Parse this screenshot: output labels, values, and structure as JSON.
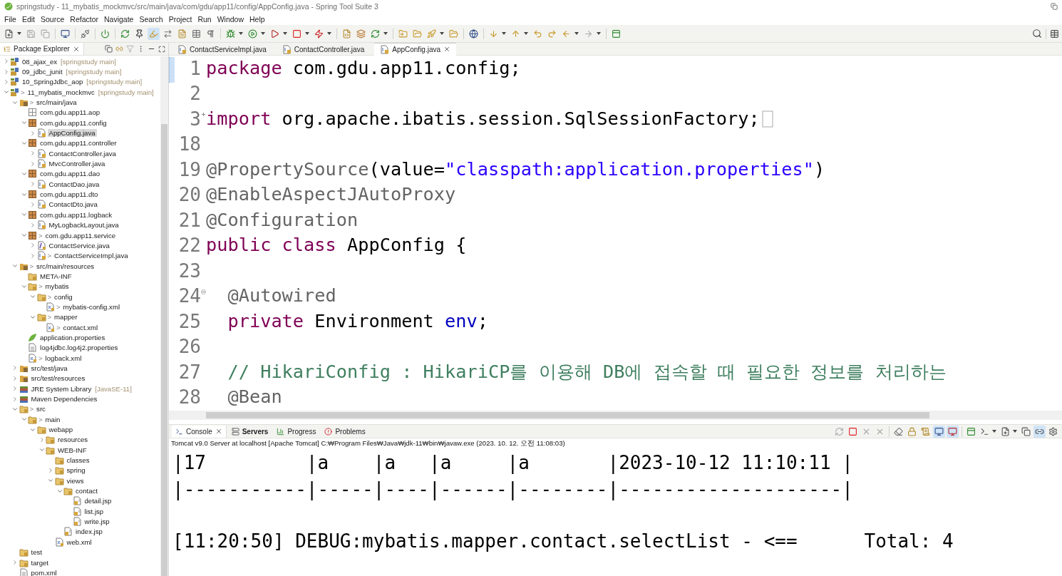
{
  "window": {
    "title": "springstudy - 11_mybatis_mockmvc/src/main/java/com/gdu/app11/config/AppConfig.java - Spring Tool Suite 3"
  },
  "menu": [
    "File",
    "Edit",
    "Source",
    "Refactor",
    "Navigate",
    "Search",
    "Project",
    "Run",
    "Window",
    "Help"
  ],
  "package_explorer": {
    "tab": {
      "label": "Package Explorer",
      "selected": true
    },
    "tree": [
      {
        "label": "08_ajax_ex",
        "decoration": "[springstudy main]",
        "kind": "project",
        "expanded": false,
        "selected": false
      },
      {
        "label": "09_jdbc_junit",
        "decoration": "[springstudy main]",
        "kind": "project",
        "expanded": false,
        "selected": false
      },
      {
        "label": "10_SpringJdbc_aop",
        "decoration": "[springstudy main]",
        "kind": "project",
        "expanded": false,
        "selected": false
      },
      {
        "label": "11_mybatis_mockmvc",
        "prefix": ">",
        "decoration": "[springstudy main]",
        "kind": "project",
        "expanded": true,
        "selected": false,
        "children": [
          {
            "label": "src/main/java",
            "prefix": ">",
            "kind": "source",
            "expanded": true,
            "selected": false,
            "children": [
              {
                "label": "com.gdu.app11.aop",
                "kind": "empty-package",
                "selected": false
              },
              {
                "label": "com.gdu.app11.config",
                "kind": "package",
                "expanded": true,
                "selected": false,
                "children": [
                  {
                    "label": "AppConfig.java",
                    "kind": "java",
                    "expanded": false,
                    "selected": true
                  }
                ]
              },
              {
                "label": "com.gdu.app11.controller",
                "kind": "package",
                "expanded": true,
                "selected": false,
                "children": [
                  {
                    "label": "ContactController.java",
                    "kind": "java",
                    "expanded": false,
                    "selected": false
                  },
                  {
                    "label": "MvcController.java",
                    "kind": "java",
                    "expanded": false,
                    "selected": false
                  }
                ]
              },
              {
                "label": "com.gdu.app11.dao",
                "kind": "package",
                "expanded": true,
                "selected": false,
                "children": [
                  {
                    "label": "ContactDao.java",
                    "kind": "java",
                    "expanded": false,
                    "selected": false
                  }
                ]
              },
              {
                "label": "com.gdu.app11.dto",
                "kind": "package",
                "expanded": true,
                "selected": false,
                "children": [
                  {
                    "label": "ContactDto.java",
                    "kind": "java",
                    "expanded": false,
                    "selected": false
                  }
                ]
              },
              {
                "label": "com.gdu.app11.logback",
                "kind": "package",
                "expanded": true,
                "selected": false,
                "children": [
                  {
                    "label": "MyLogbackLayout.java",
                    "kind": "java",
                    "expanded": false,
                    "selected": false
                  }
                ]
              },
              {
                "label": "com.gdu.app11.service",
                "prefix": ">",
                "kind": "package",
                "expanded": true,
                "selected": false,
                "children": [
                  {
                    "label": "ContactService.java",
                    "kind": "interface",
                    "expanded": false,
                    "selected": false
                  },
                  {
                    "label": "ContactServiceImpl.java",
                    "prefix": ">",
                    "kind": "java",
                    "expanded": false,
                    "selected": false
                  }
                ]
              }
            ]
          },
          {
            "label": "src/main/resources",
            "prefix": ">",
            "kind": "source",
            "expanded": true,
            "selected": false,
            "children": [
              {
                "label": "META-INF",
                "kind": "folder",
                "selected": false
              },
              {
                "label": "mybatis",
                "prefix": ">",
                "kind": "folder",
                "expanded": true,
                "selected": false,
                "children": [
                  {
                    "label": "config",
                    "prefix": ">",
                    "kind": "folder",
                    "expanded": true,
                    "selected": false,
                    "children": [
                      {
                        "label": "mybatis-config.xml",
                        "prefix": ">",
                        "kind": "xml",
                        "selected": false
                      }
                    ]
                  },
                  {
                    "label": "mapper",
                    "prefix": ">",
                    "kind": "folder",
                    "expanded": true,
                    "selected": false,
                    "children": [
                      {
                        "label": "contact.xml",
                        "prefix": ">",
                        "kind": "xml",
                        "selected": false
                      }
                    ]
                  }
                ]
              },
              {
                "label": "application.properties",
                "kind": "spring",
                "selected": false
              },
              {
                "label": "log4jdbc.log4j2.properties",
                "kind": "file",
                "selected": false
              },
              {
                "label": "logback.xml",
                "prefix": ">",
                "kind": "xml",
                "selected": false
              }
            ]
          },
          {
            "label": "src/test/java",
            "kind": "source",
            "expanded": false,
            "selected": false
          },
          {
            "label": "src/test/resources",
            "kind": "source",
            "expanded": false,
            "selected": false
          },
          {
            "label": "JRE System Library",
            "decoration": "[JavaSE-11]",
            "kind": "library",
            "expanded": false,
            "selected": false
          },
          {
            "label": "Maven Dependencies",
            "kind": "library",
            "expanded": false,
            "selected": false
          },
          {
            "label": "src",
            "prefix": ">",
            "kind": "folder",
            "expanded": true,
            "selected": false,
            "children": [
              {
                "label": "main",
                "prefix": ">",
                "kind": "folder",
                "expanded": true,
                "selected": false,
                "children": [
                  {
                    "label": "webapp",
                    "kind": "folder",
                    "expanded": true,
                    "selected": false,
                    "children": [
                      {
                        "label": "resources",
                        "kind": "folder",
                        "expanded": false,
                        "selected": false
                      },
                      {
                        "label": "WEB-INF",
                        "kind": "folder",
                        "expanded": true,
                        "selected": false,
                        "children": [
                          {
                            "label": "classes",
                            "kind": "folder",
                            "selected": false
                          },
                          {
                            "label": "spring",
                            "kind": "folder",
                            "expanded": false,
                            "selected": false
                          },
                          {
                            "label": "views",
                            "kind": "folder",
                            "expanded": true,
                            "selected": false,
                            "children": [
                              {
                                "label": "contact",
                                "kind": "folder",
                                "expanded": true,
                                "selected": false,
                                "children": [
                                  {
                                    "label": "detail.jsp",
                                    "kind": "jsp",
                                    "selected": false
                                  },
                                  {
                                    "label": "list.jsp",
                                    "kind": "jsp",
                                    "selected": false
                                  },
                                  {
                                    "label": "write.jsp",
                                    "kind": "jsp",
                                    "selected": false
                                  }
                                ]
                              },
                              {
                                "label": "index.jsp",
                                "kind": "jsp",
                                "selected": false
                              }
                            ]
                          },
                          {
                            "label": "web.xml",
                            "kind": "xml",
                            "selected": false
                          }
                        ]
                      }
                    ]
                  }
                ]
              }
            ]
          },
          {
            "label": "test",
            "kind": "folder",
            "selected": false
          },
          {
            "label": "target",
            "kind": "folder",
            "expanded": false,
            "selected": false
          },
          {
            "label": "pom.xml",
            "kind": "file",
            "selected": false
          }
        ]
      }
    ]
  },
  "editor": {
    "tabs": [
      {
        "label": "ContactServiceImpl.java",
        "selected": false
      },
      {
        "label": "ContactController.java",
        "selected": false
      },
      {
        "label": "AppConfig.java",
        "selected": true
      }
    ],
    "lines": [
      {
        "number": "1",
        "tokens": [
          {
            "text": "package",
            "kind": "keyword"
          },
          {
            "text": " com.gdu.app11.config;",
            "kind": "plain"
          }
        ]
      },
      {
        "number": "2"
      },
      {
        "number": "3",
        "folded": true,
        "tokens": [
          {
            "text": "import",
            "kind": "keyword"
          },
          {
            "text": " org.apache.ibatis.session.SqlSessionFactory;",
            "kind": "plain"
          }
        ]
      },
      {
        "number": "18"
      },
      {
        "number": "19",
        "tokens": [
          {
            "text": "@PropertySource",
            "kind": "annotation"
          },
          {
            "text": "(value=",
            "kind": "plain"
          },
          {
            "text": "\"classpath:application.properties\"",
            "kind": "string"
          },
          {
            "text": ")",
            "kind": "plain"
          }
        ]
      },
      {
        "number": "20",
        "tokens": [
          {
            "text": "@EnableAspectJAutoProxy",
            "kind": "annotation"
          }
        ]
      },
      {
        "number": "21",
        "tokens": [
          {
            "text": "@Configuration",
            "kind": "annotation"
          }
        ]
      },
      {
        "number": "22",
        "tokens": [
          {
            "text": "public class",
            "kind": "keyword"
          },
          {
            "text": " AppConfig {",
            "kind": "plain"
          }
        ]
      },
      {
        "number": "23"
      },
      {
        "number": "24",
        "folded": false,
        "tokens": [
          {
            "text": "  @Autowired",
            "kind": "annotation"
          }
        ]
      },
      {
        "number": "25",
        "tokens": [
          {
            "text": "  private",
            "kind": "keyword"
          },
          {
            "text": " Environment ",
            "kind": "plain"
          },
          {
            "text": "env",
            "kind": "field"
          },
          {
            "text": ";",
            "kind": "plain"
          }
        ]
      },
      {
        "number": "26"
      },
      {
        "number": "27",
        "tokens": [
          {
            "text": "  // HikariConfig : HikariCP를 이용해 DB에 접속할 때 필요한 정보를 처리하는",
            "kind": "comment"
          }
        ]
      },
      {
        "number": "28",
        "tokens": [
          {
            "text": "  @Bean",
            "kind": "annotation"
          }
        ]
      }
    ]
  },
  "console": {
    "tabs": [
      {
        "label": "Console",
        "kind": "console",
        "selected": true,
        "bold": false
      },
      {
        "label": "Servers",
        "kind": "servers",
        "selected": false,
        "bold": true
      },
      {
        "label": "Progress",
        "kind": "progress",
        "selected": false,
        "bold": false
      },
      {
        "label": "Problems",
        "kind": "problems",
        "selected": false,
        "bold": false
      }
    ],
    "process": "Tomcat v9.0 Server at localhost [Apache Tomcat] C:₩Program Files₩Java₩jdk-11₩bin₩javaw.exe  (2023. 10. 12. 오전 11:08:03)",
    "table_lines": [
      "|17         |a    |a   |a     |a       |2023-10-12 11:10:11 |",
      "|-----------|-----|----|------|--------|--------------------|"
    ],
    "log_lines": [
      "[11:20:50] DEBUG:mybatis.mapper.contact.selectList - <==      Total: 4"
    ]
  }
}
